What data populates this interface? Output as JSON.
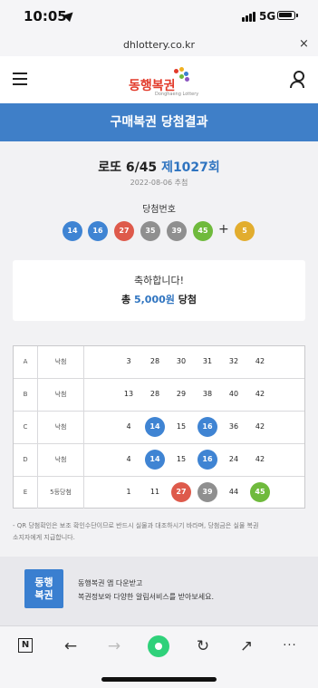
{
  "status_bar": {
    "time": "10:05",
    "network": "5G"
  },
  "url_bar": {
    "url": "dhlottery.co.kr",
    "close_icon": "×"
  },
  "header": {
    "logo_text": "동행복권",
    "logo_sub": "Donghaeng Lottery"
  },
  "banner": {
    "title": "구매복권 당첨결과"
  },
  "draw": {
    "game_name": "로또 6/45",
    "round": "제1027회",
    "date": "2022-08-06 추첨",
    "winning_title": "당첨번호",
    "numbers": [
      {
        "value": "14",
        "color": "#3f84d3"
      },
      {
        "value": "16",
        "color": "#3f84d3"
      },
      {
        "value": "27",
        "color": "#de5a4b"
      },
      {
        "value": "35",
        "color": "#8f8f8f"
      },
      {
        "value": "39",
        "color": "#8f8f8f"
      },
      {
        "value": "45",
        "color": "#6fba3c"
      }
    ],
    "plus": "+",
    "bonus": {
      "value": "5",
      "color": "#e2ad2e"
    }
  },
  "result_card": {
    "congrats": "축하합니다!",
    "prize_prefix": "총",
    "prize_amount": "5,000원",
    "prize_suffix": "당첨"
  },
  "tickets": [
    {
      "label": "A",
      "result": "낙첨",
      "numbers": [
        {
          "v": "3",
          "hit": false
        },
        {
          "v": "28",
          "hit": false
        },
        {
          "v": "30",
          "hit": false
        },
        {
          "v": "31",
          "hit": false
        },
        {
          "v": "32",
          "hit": false
        },
        {
          "v": "42",
          "hit": false
        }
      ]
    },
    {
      "label": "B",
      "result": "낙첨",
      "numbers": [
        {
          "v": "13",
          "hit": false
        },
        {
          "v": "28",
          "hit": false
        },
        {
          "v": "29",
          "hit": false
        },
        {
          "v": "38",
          "hit": false
        },
        {
          "v": "40",
          "hit": false
        },
        {
          "v": "42",
          "hit": false
        }
      ]
    },
    {
      "label": "C",
      "result": "낙첨",
      "numbers": [
        {
          "v": "4",
          "hit": false
        },
        {
          "v": "14",
          "hit": true,
          "color": "#3f84d3"
        },
        {
          "v": "15",
          "hit": false
        },
        {
          "v": "16",
          "hit": true,
          "color": "#3f84d3"
        },
        {
          "v": "36",
          "hit": false
        },
        {
          "v": "42",
          "hit": false
        }
      ]
    },
    {
      "label": "D",
      "result": "낙첨",
      "numbers": [
        {
          "v": "4",
          "hit": false
        },
        {
          "v": "14",
          "hit": true,
          "color": "#3f84d3"
        },
        {
          "v": "15",
          "hit": false
        },
        {
          "v": "16",
          "hit": true,
          "color": "#3f84d3"
        },
        {
          "v": "24",
          "hit": false
        },
        {
          "v": "42",
          "hit": false
        }
      ]
    },
    {
      "label": "E",
      "result": "5등당첨",
      "numbers": [
        {
          "v": "1",
          "hit": false
        },
        {
          "v": "11",
          "hit": false
        },
        {
          "v": "27",
          "hit": true,
          "color": "#de5a4b"
        },
        {
          "v": "39",
          "hit": true,
          "color": "#8f8f8f"
        },
        {
          "v": "44",
          "hit": false
        },
        {
          "v": "45",
          "hit": true,
          "color": "#6fba3c"
        }
      ]
    }
  ],
  "note": {
    "line1": "- QR 당첨확인은 보조 확인수단이므로 반드시 실물과 대조하시기 바라며, 당첨금은 실물 복권",
    "line2": "소지자에게 지급합니다."
  },
  "promo": {
    "logo_line1": "동행",
    "logo_line2": "복권",
    "line1": "동행복권 앱 다운받고",
    "line2": "복권정보와 다양한 알림서비스를 받아보세요."
  },
  "toolbar": {
    "naver": "N",
    "back": "←",
    "forward": "→",
    "reload": "↻",
    "share": "↗",
    "more": "···"
  },
  "colors": {
    "accent": "#3f7fc8",
    "page_bg": "#f2f2f4"
  }
}
